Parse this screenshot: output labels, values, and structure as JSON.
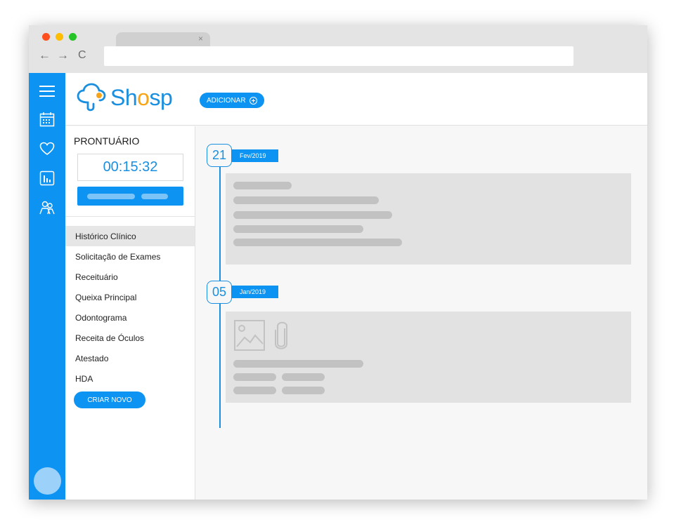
{
  "browser": {
    "tab_close": "×",
    "back": "←",
    "forward": "→",
    "reload": "C"
  },
  "header": {
    "logo_text_start": "Sh",
    "logo_text_o": "o",
    "logo_text_end": "sp",
    "add_button_label": "ADICIONAR"
  },
  "prontuario": {
    "title": "PRONTUÁRIO",
    "timer": "00:15:32"
  },
  "menu": {
    "items": [
      {
        "label": "Histórico Clínico"
      },
      {
        "label": "Solicitação de Exames"
      },
      {
        "label": "Receituário"
      },
      {
        "label": "Queixa Principal"
      },
      {
        "label": "Odontograma"
      },
      {
        "label": "Receita de Óculos"
      },
      {
        "label": "Atestado"
      },
      {
        "label": "HDA"
      }
    ],
    "new_button_label": "CRIAR NOVO"
  },
  "timeline": {
    "entries": [
      {
        "day": "21",
        "month": "Fev/2019"
      },
      {
        "day": "05",
        "month": "Jan/2019"
      }
    ]
  },
  "colors": {
    "primary": "#0d93f2",
    "accent_orange": "#f7a419",
    "placeholder": "#c2c2c2"
  },
  "icons": {
    "sidebar": [
      "menu-icon",
      "calendar-icon",
      "heart-icon",
      "chart-icon",
      "patients-icon"
    ],
    "attachments": [
      "image-icon",
      "paperclip-icon"
    ]
  }
}
